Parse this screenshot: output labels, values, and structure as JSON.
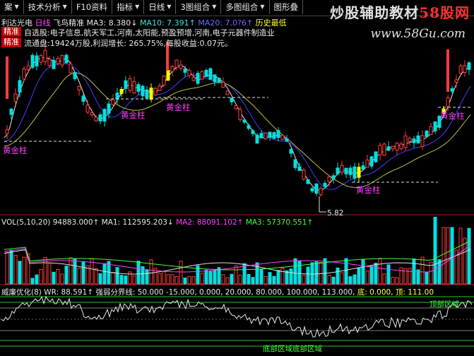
{
  "toolbar": {
    "items": [
      {
        "label": "案",
        "has_dropdown": true
      },
      {
        "label": "技术分析",
        "has_dropdown": true
      },
      {
        "label": "F10资料",
        "has_dropdown": false
      },
      {
        "label": "指标",
        "has_dropdown": true
      },
      {
        "label": "日线",
        "has_dropdown": true
      },
      {
        "label": "3图组合",
        "has_dropdown": true
      },
      {
        "label": "多图组合",
        "has_dropdown": true
      },
      {
        "label": "图形叠",
        "has_dropdown": false
      }
    ]
  },
  "watermark": {
    "part1": "炒股辅助教材",
    "part2": "58股网",
    "url": "www.58Gu.com"
  },
  "main_panel": {
    "stock_name": "利达光电",
    "period": "日线",
    "indicator_name": "飞鸟精准",
    "ma3": "MA3: 8.380↓",
    "ma10": "MA10: 7.391↑",
    "ma_hidden": "MA20: 7.0?6↑",
    "history_label": "历史最低",
    "badge_top": "精准",
    "badge_bottom": "精准",
    "info_line1": "自选股:电子信息,航天军工,河南,太阳能,预盈预增,河南,电子元器件制造业",
    "info_line2": "流通盘:19424万股,利润增长: 265.75%,每股收益:0.07元。",
    "golden_label": "黄金柱",
    "low_label": "5.82",
    "colors": {
      "up": "#ff3c3c",
      "down": "#00e0e0",
      "golden": "#ffff00",
      "ma_short": "#e0e0e0",
      "ma_mid": "#4040ff",
      "ma_long": "#c0c040"
    }
  },
  "vol_panel": {
    "title": "VOL(5,10,20)",
    "v1": "94883.000↑",
    "ma1": "MA1: 112595.203↓",
    "ma2": "MA2: 88091.102↑",
    "ma3": "MA3: 57370.551↑"
  },
  "ind_panel": {
    "title": "威廉优化(8)",
    "wr": "WR: 88.591↑",
    "strength_line": "强弱分界线: 50.000",
    "values": "-15.000, 0.000, 20.000, 80.000, 100.000, 113.000,",
    "bottom_label": "底: 0.000,",
    "top_label": "顶: 111.00",
    "top_zone": "顶部区域",
    "bottom_zone": "底部区域底部区域"
  }
}
